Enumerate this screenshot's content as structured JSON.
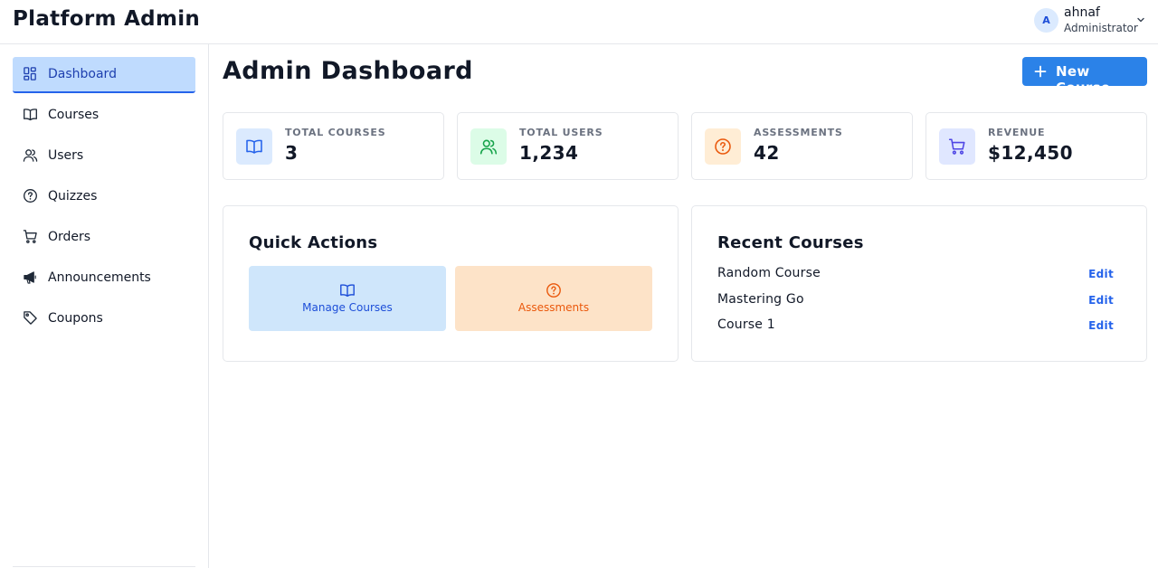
{
  "app": {
    "title": "Platform Admin"
  },
  "user": {
    "initial": "A",
    "name": "ahnaf",
    "role": "Administrator",
    "menu_icon": "chevron-down-icon"
  },
  "sidebar": {
    "items": [
      {
        "label": "Dashboard",
        "icon": "dashboard-icon",
        "active": true
      },
      {
        "label": "Courses",
        "icon": "book-icon"
      },
      {
        "label": "Users",
        "icon": "users-icon"
      },
      {
        "label": "Quizzes",
        "icon": "question-circle-icon"
      },
      {
        "label": "Orders",
        "icon": "cart-icon"
      },
      {
        "label": "Announcements",
        "icon": "megaphone-icon"
      },
      {
        "label": "Coupons",
        "icon": "tag-icon"
      }
    ]
  },
  "header": {
    "title": "Admin Dashboard",
    "new_course_label": "New Course"
  },
  "stats": [
    {
      "label": "TOTAL COURSES",
      "value": "3",
      "icon": "book-icon",
      "color": "#2563eb",
      "bg": "#dbeafe"
    },
    {
      "label": "TOTAL USERS",
      "value": "1,234",
      "icon": "users-icon",
      "color": "#16a34a",
      "bg": "#dcfce7"
    },
    {
      "label": "ASSESSMENTS",
      "value": "42",
      "icon": "question-circle-icon",
      "color": "#ea580c",
      "bg": "#ffedd5"
    },
    {
      "label": "REVENUE",
      "value": "$12,450",
      "icon": "cart-icon",
      "color": "#4f46e5",
      "bg": "#e0e7ff"
    }
  ],
  "quick_actions": {
    "title": "Quick Actions",
    "buttons": [
      {
        "label": "Manage Courses",
        "icon": "book-icon",
        "color": "#1d4ed8",
        "bg": "#cfe6fb"
      },
      {
        "label": "Assessments",
        "icon": "question-circle-icon",
        "color": "#ea580c",
        "bg": "#fde3c8"
      }
    ]
  },
  "recent_courses": {
    "title": "Recent Courses",
    "edit_label": "Edit",
    "items": [
      {
        "name": "Random Course"
      },
      {
        "name": "Mastering Go"
      },
      {
        "name": "Course 1"
      }
    ]
  }
}
